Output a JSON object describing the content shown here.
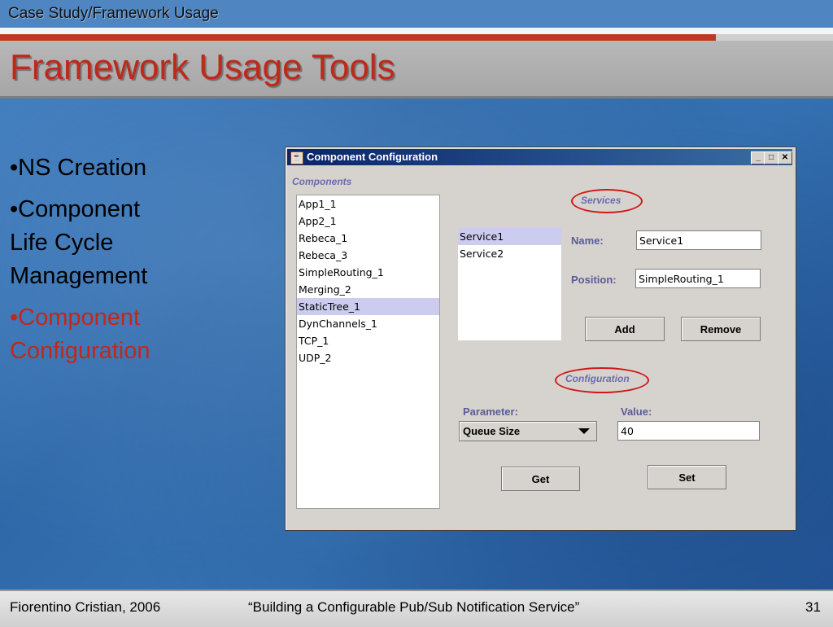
{
  "slide": {
    "section": "Case Study/Framework Usage",
    "title": "Framework Usage Tools",
    "bullets": [
      {
        "text": "•NS Creation"
      },
      {
        "text": "•Component Life Cycle Management"
      },
      {
        "text": "•Component Configuration"
      }
    ],
    "footer": {
      "author": "Fiorentino Cristian, 2006",
      "talk": "“Building a Configurable Pub/Sub Notification Service”",
      "page": "31"
    }
  },
  "window": {
    "title": "Component Configuration",
    "controls": {
      "minimize": "_",
      "maximize": "□",
      "close": "✕"
    },
    "components_label": "Components",
    "components": [
      "App1_1",
      "App2_1",
      "Rebeca_1",
      "Rebeca_3",
      "SimpleRouting_1",
      "Merging_2",
      "StaticTree_1",
      "DynChannels_1",
      "TCP_1",
      "UDP_2"
    ],
    "selected_component": "StaticTree_1",
    "services_label": "Services",
    "services": [
      "Service1",
      "Service2"
    ],
    "selected_service": "Service1",
    "name_label": "Name:",
    "name_value": "Service1",
    "position_label": "Position:",
    "position_value": "SimpleRouting_1",
    "add_label": "Add",
    "remove_label": "Remove",
    "configuration_label": "Configuration",
    "parameter_label": "Parameter:",
    "parameter_value": "Queue Size",
    "value_label": "Value:",
    "value_value": "40",
    "get_label": "Get",
    "set_label": "Set"
  },
  "colors": {
    "accent_red": "#c0281a",
    "list_selection": "#ccccf0",
    "titlebar_blue": "#0a246a",
    "highlight_ellipse": "#d01818"
  }
}
